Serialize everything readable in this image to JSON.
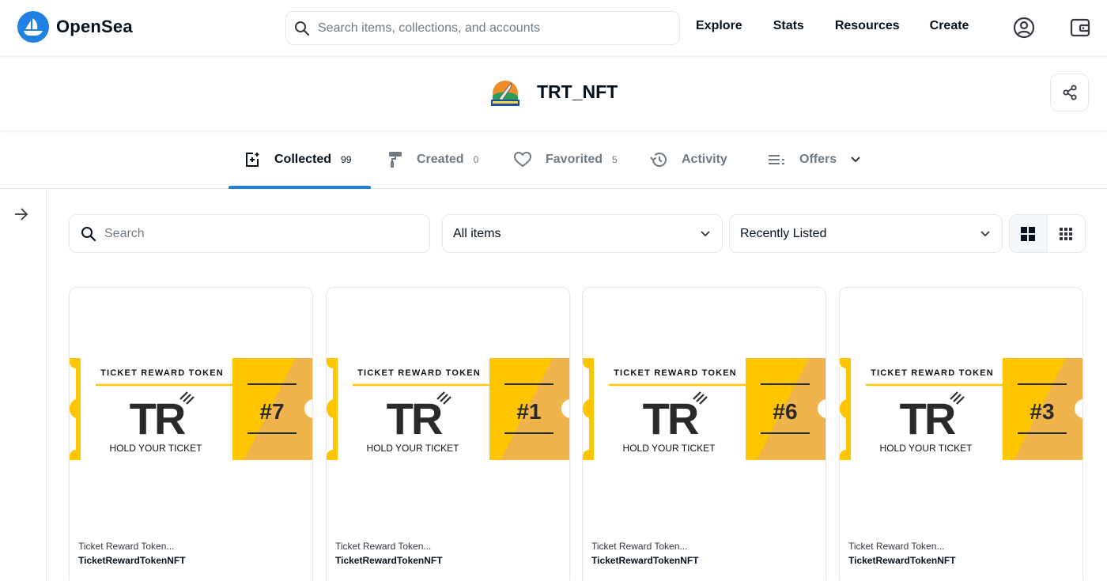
{
  "brand": {
    "name": "OpenSea"
  },
  "nav": {
    "search_placeholder": "Search items, collections, and accounts",
    "links": [
      "Explore",
      "Stats",
      "Resources",
      "Create"
    ]
  },
  "profile": {
    "name": "TRT_NFT"
  },
  "tabs": [
    {
      "label": "Collected",
      "count": "99",
      "active": true
    },
    {
      "label": "Created",
      "count": "0"
    },
    {
      "label": "Favorited",
      "count": "5"
    },
    {
      "label": "Activity",
      "count": ""
    },
    {
      "label": "Offers",
      "count": ""
    }
  ],
  "filters": {
    "search_placeholder": "Search",
    "items_select": "All items",
    "sort_select": "Recently Listed"
  },
  "ticket": {
    "header": "TICKET REWARD TOKEN",
    "logo": "TR",
    "tagline": "HOLD YOUR TICKET"
  },
  "cards": [
    {
      "number": "#7",
      "collection": "Ticket Reward Token...",
      "name": "TicketRewardTokenNFT"
    },
    {
      "number": "#1",
      "collection": "Ticket Reward Token...",
      "name": "TicketRewardTokenNFT"
    },
    {
      "number": "#6",
      "collection": "Ticket Reward Token...",
      "name": "TicketRewardTokenNFT"
    },
    {
      "number": "#3",
      "collection": "Ticket Reward Token...",
      "name": "TicketRewardTokenNFT"
    }
  ],
  "colors": {
    "accent": "#2081e2",
    "ticket_yellow": "#ffc600",
    "ticket_orange": "#f0b44c",
    "text_dark": "#04111d",
    "text_muted": "#707a83",
    "border": "#e5e8eb"
  }
}
